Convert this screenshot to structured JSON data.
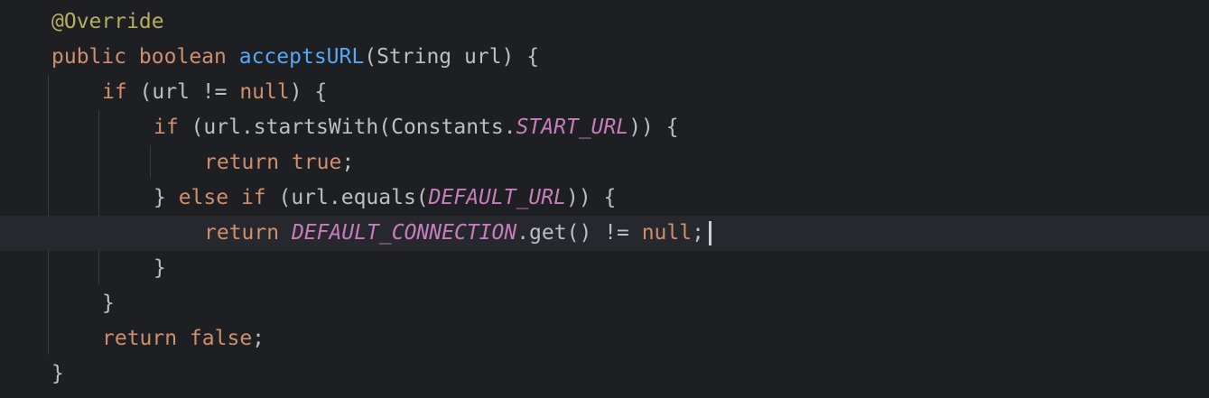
{
  "editor": {
    "language": "Java",
    "theme_colors": {
      "background": "#1e1f22",
      "current_line": "#26282e",
      "keyword": "#cf8e6d",
      "annotation": "#b3ae60",
      "method_declaration": "#56a8f5",
      "constant": "#c77dbb",
      "default_text": "#bcbec4"
    },
    "lines": [
      {
        "t1": "@Override"
      },
      {
        "t1": "public boolean",
        "t2": " ",
        "t3": "acceptsURL",
        "t4": "(String url) {"
      },
      {
        "t1": "if",
        "t2": " (url != ",
        "t3": "null",
        "t4": ") {"
      },
      {
        "t1": "if",
        "t2": " (url.startsWith(Constants.",
        "t3": "START_URL",
        "t4": ")) {"
      },
      {
        "t1": "return true",
        "t2": ";"
      },
      {
        "t1": "} ",
        "t2": "else if",
        "t3": " (url.equals(",
        "t4": "DEFAULT_URL",
        "t5": ")) {"
      },
      {
        "t1": "return",
        "t2": " ",
        "t3": "DEFAULT_CONNECTION",
        "t4": ".get() != ",
        "t5": "null",
        "t6": ";"
      },
      {
        "t1": "}"
      },
      {
        "t1": "}"
      },
      {
        "t1": "return false",
        "t2": ";"
      },
      {
        "t1": "}"
      }
    ]
  }
}
